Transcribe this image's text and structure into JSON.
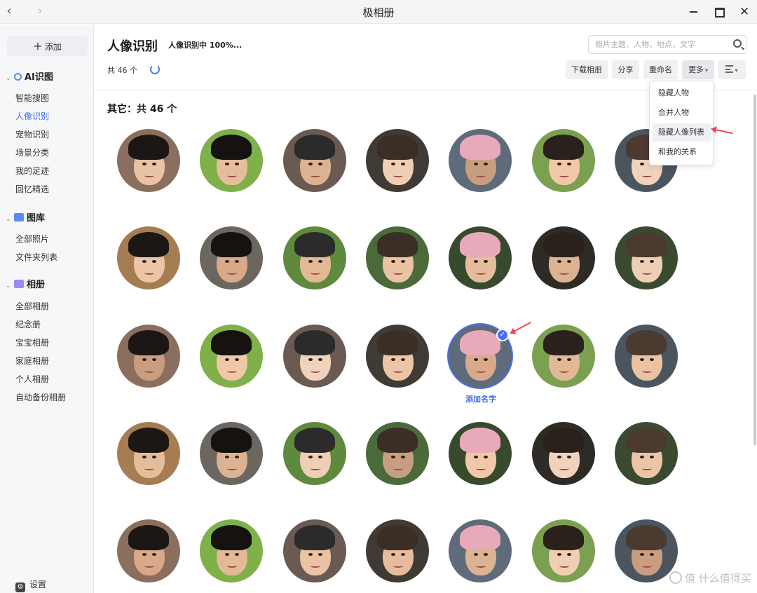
{
  "window": {
    "title": "极相册"
  },
  "sidebar": {
    "add_label": "添加",
    "sections": [
      {
        "label": "AI识图",
        "items": [
          "智能搜图",
          "人像识别",
          "宠物识别",
          "场景分类",
          "我的足迹",
          "回忆精选"
        ]
      },
      {
        "label": "图库",
        "items": [
          "全部照片",
          "文件夹列表"
        ]
      },
      {
        "label": "相册",
        "items": [
          "全部相册",
          "纪念册",
          "宝宝相册",
          "家庭相册",
          "个人相册",
          "自动备份相册"
        ]
      }
    ],
    "active_item": "人像识别",
    "settings_label": "设置"
  },
  "header": {
    "title": "人像识别",
    "progress": "人像识别中 100%...",
    "count": "共 46 个"
  },
  "search": {
    "placeholder": "照片主题、人物、地点、文字"
  },
  "toolbar": {
    "download": "下载相册",
    "share": "分享",
    "rename": "重命名",
    "more": "更多"
  },
  "more_menu": [
    "隐藏人物",
    "合并人物",
    "隐藏人像列表",
    "和我的关系"
  ],
  "group": {
    "title": "其它：共 46 个"
  },
  "selected_face": {
    "label": "添加名字"
  },
  "watermark": "值 什么值得买",
  "colors": {
    "accent": "#3d6df2",
    "annotation_arrow": "#f0455a"
  }
}
